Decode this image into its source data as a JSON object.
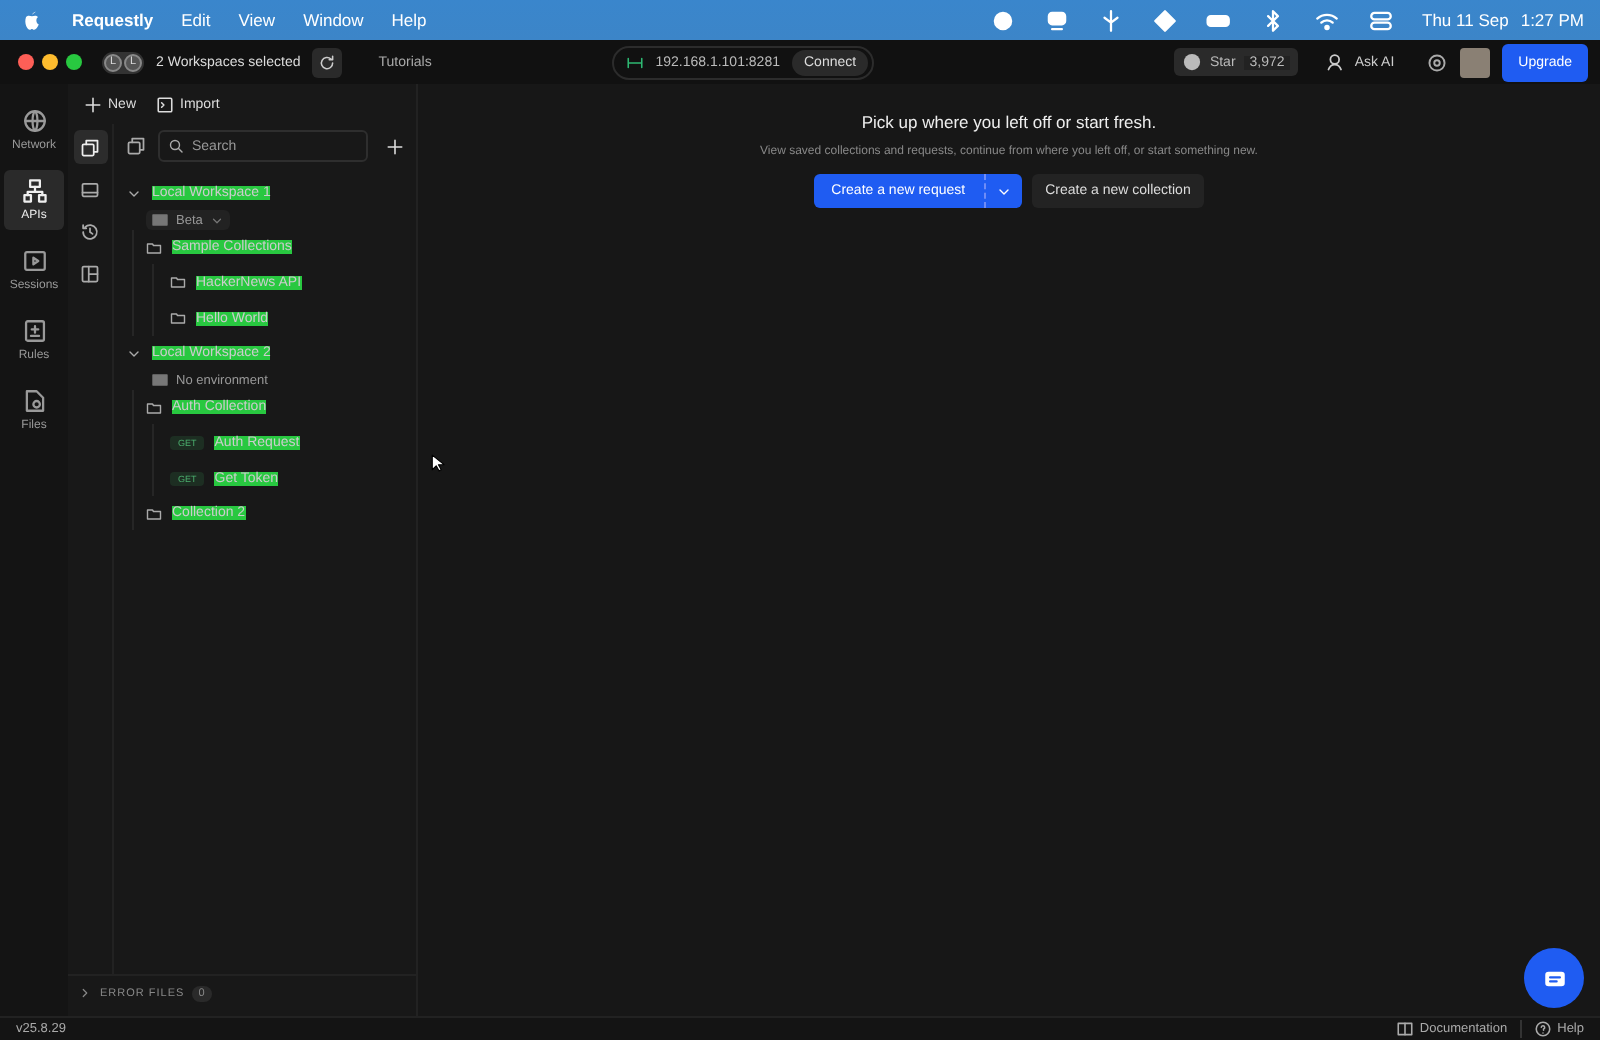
{
  "menubar": {
    "items": [
      {
        "label": "Requestly",
        "kind": "app"
      },
      {
        "label": "Edit",
        "kind": "menu"
      },
      {
        "label": "View",
        "kind": "menu"
      },
      {
        "label": "Window",
        "kind": "menu"
      },
      {
        "label": "Help",
        "kind": "menu"
      }
    ],
    "date": "Thu 11 Sep",
    "time": "1:27 PM"
  },
  "titlebar": {
    "avatars": [
      "L",
      "L"
    ],
    "workspace_selector": "2 Workspaces selected",
    "tutorials": "Tutorials",
    "proxy": "192.168.1.101:8281",
    "connect": "Connect",
    "star": "Star",
    "star_count": "3,972",
    "ask_ai": "Ask AI",
    "upgrade": "Upgrade"
  },
  "rail": [
    {
      "label": "Network",
      "selected": false
    },
    {
      "label": "APIs",
      "selected": true
    },
    {
      "label": "Sessions",
      "selected": false
    },
    {
      "label": "Rules",
      "selected": false
    },
    {
      "label": "Files",
      "selected": false
    }
  ],
  "side_tabs": [
    {
      "selected": true
    },
    {
      "selected": false
    },
    {
      "selected": false
    },
    {
      "selected": false
    }
  ],
  "sidebar": {
    "new": "New",
    "import": "Import",
    "search": {
      "placeholder": "Search"
    },
    "tree": [
      {
        "kind": "workspace",
        "label": "Local Workspace 1",
        "expanded": true,
        "environment": "Beta",
        "env_dropdown": true,
        "children": [
          {
            "kind": "collection",
            "label": "Sample Collections",
            "children": [
              {
                "kind": "collection",
                "label": "HackerNews API"
              },
              {
                "kind": "collection",
                "label": "Hello World"
              }
            ]
          }
        ]
      },
      {
        "kind": "workspace",
        "label": "Local Workspace 2",
        "expanded": true,
        "environment": "No environment",
        "env_dropdown": false,
        "children": [
          {
            "kind": "collection",
            "label": "Auth Collection",
            "children": [
              {
                "kind": "request",
                "method": "GET",
                "label": "Auth Request"
              },
              {
                "kind": "request",
                "method": "GET",
                "label": "Get Token"
              }
            ]
          },
          {
            "kind": "collection",
            "label": "Collection 2"
          }
        ]
      }
    ],
    "error_files": {
      "label": "ERROR FILES",
      "count": "0",
      "expanded": false
    }
  },
  "main": {
    "heading": "Pick up where you left off or start fresh.",
    "subtext": "View saved collections and requests, continue from where you left off, or start something new.",
    "primary": "Create a new request",
    "secondary": "Create a new collection"
  },
  "status_bar": {
    "version": "v25.8.29",
    "documentation": "Documentation",
    "help": "Help"
  }
}
